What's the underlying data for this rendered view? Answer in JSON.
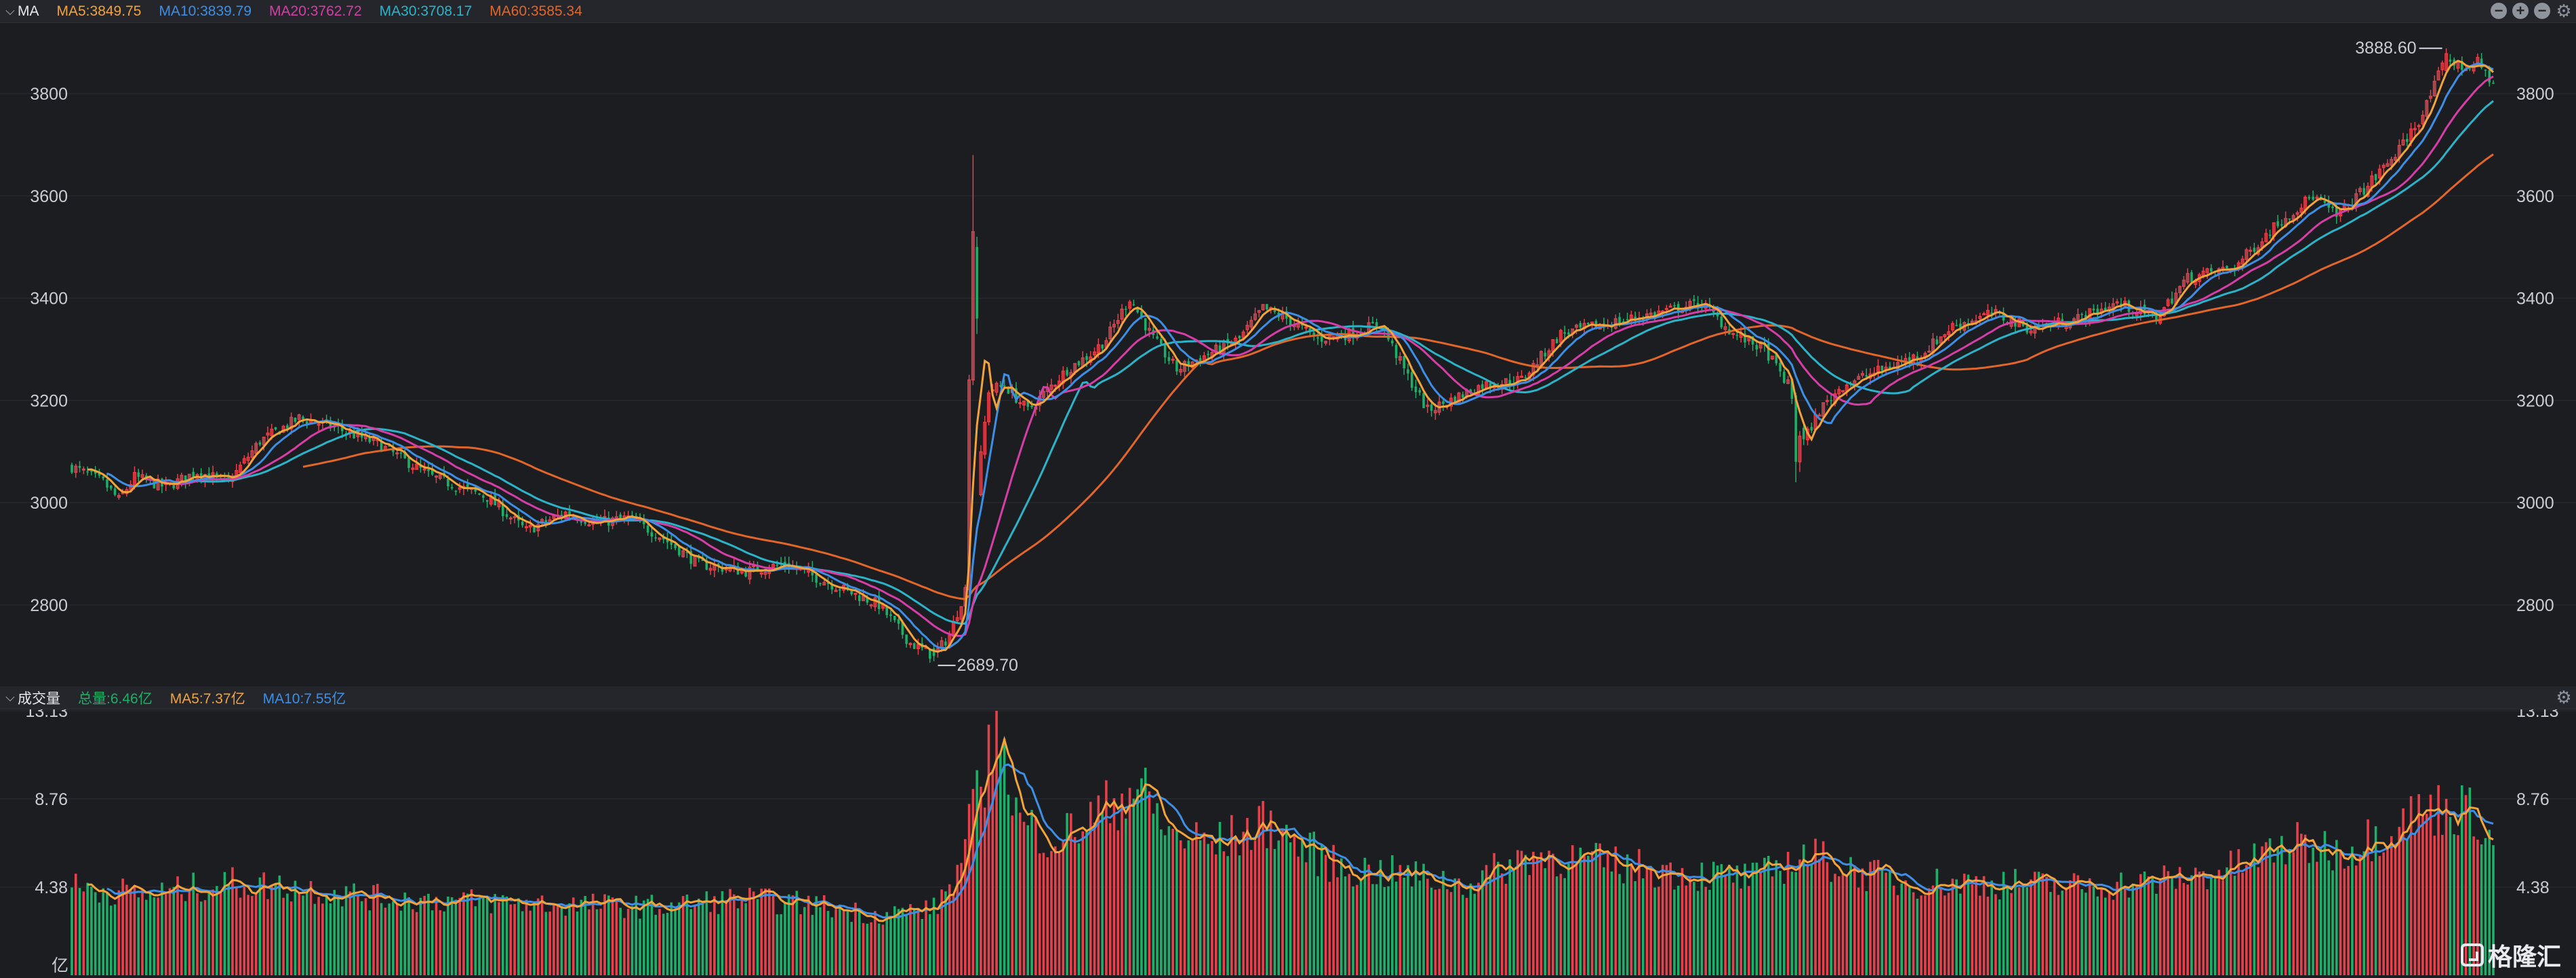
{
  "main_header": {
    "title": "MA",
    "ma5": "MA5:3849.75",
    "ma10": "MA10:3839.79",
    "ma20": "MA20:3762.72",
    "ma30": "MA30:3708.17",
    "ma60": "MA60:3585.34"
  },
  "volume_header": {
    "title": "成交量",
    "total": "总量:6.46亿",
    "ma5": "MA5:7.37亿",
    "ma10": "MA10:7.55亿"
  },
  "colors": {
    "up": "#e5414a",
    "down": "#1fae67",
    "ma5": "#f2a33a",
    "ma10": "#3d8fe6",
    "ma20": "#d63ea7",
    "ma30": "#2bb4c9",
    "ma60": "#e2662a"
  },
  "watermark": "格隆汇",
  "chart_data": [
    {
      "type": "candlestick",
      "y_ticks": [
        "3800",
        "3600",
        "3400",
        "3200",
        "3000",
        "2800"
      ],
      "ylim": [
        2650,
        3930
      ],
      "grid": true,
      "annotations": {
        "high": "3888.60",
        "low": "2689.70"
      },
      "anchors": [
        [
          0,
          3070
        ],
        [
          8,
          3040
        ],
        [
          12,
          3005
        ],
        [
          16,
          3050
        ],
        [
          24,
          3030
        ],
        [
          32,
          3060
        ],
        [
          40,
          3040
        ],
        [
          48,
          3120
        ],
        [
          58,
          3165
        ],
        [
          66,
          3150
        ],
        [
          78,
          3115
        ],
        [
          92,
          3050
        ],
        [
          106,
          3010
        ],
        [
          116,
          2945
        ],
        [
          126,
          2980
        ],
        [
          134,
          2960
        ],
        [
          142,
          2970
        ],
        [
          150,
          2935
        ],
        [
          160,
          2880
        ],
        [
          172,
          2865
        ],
        [
          182,
          2880
        ],
        [
          194,
          2840
        ],
        [
          206,
          2800
        ],
        [
          214,
          2725
        ],
        [
          220,
          2700
        ],
        [
          224,
          2740
        ],
        [
          228,
          2830
        ],
        [
          234,
          3220
        ],
        [
          238,
          3230
        ],
        [
          244,
          3180
        ],
        [
          254,
          3260
        ],
        [
          260,
          3290
        ],
        [
          264,
          3320
        ],
        [
          270,
          3400
        ],
        [
          276,
          3320
        ],
        [
          282,
          3260
        ],
        [
          290,
          3290
        ],
        [
          298,
          3320
        ],
        [
          304,
          3380
        ],
        [
          310,
          3360
        ],
        [
          318,
          3320
        ],
        [
          326,
          3330
        ],
        [
          334,
          3350
        ],
        [
          340,
          3260
        ],
        [
          346,
          3180
        ],
        [
          352,
          3200
        ],
        [
          360,
          3230
        ],
        [
          370,
          3240
        ],
        [
          380,
          3330
        ],
        [
          392,
          3350
        ],
        [
          404,
          3370
        ],
        [
          416,
          3390
        ],
        [
          424,
          3330
        ],
        [
          432,
          3300
        ],
        [
          438,
          3230
        ],
        [
          442,
          3120
        ],
        [
          446,
          3180
        ],
        [
          452,
          3230
        ],
        [
          462,
          3260
        ],
        [
          472,
          3290
        ],
        [
          480,
          3345
        ],
        [
          490,
          3370
        ],
        [
          500,
          3340
        ],
        [
          512,
          3360
        ],
        [
          522,
          3390
        ],
        [
          532,
          3360
        ],
        [
          540,
          3440
        ],
        [
          552,
          3460
        ],
        [
          562,
          3540
        ],
        [
          572,
          3600
        ],
        [
          578,
          3560
        ],
        [
          586,
          3620
        ],
        [
          594,
          3690
        ],
        [
          600,
          3760
        ],
        [
          606,
          3870
        ],
        [
          610,
          3850
        ],
        [
          614,
          3860
        ],
        [
          618,
          3820
        ]
      ],
      "volume_anchors": [
        [
          0,
          4.4
        ],
        [
          20,
          4.0
        ],
        [
          40,
          4.6
        ],
        [
          60,
          4.3
        ],
        [
          80,
          3.8
        ],
        [
          100,
          3.7
        ],
        [
          130,
          3.5
        ],
        [
          150,
          3.4
        ],
        [
          170,
          3.8
        ],
        [
          190,
          3.5
        ],
        [
          205,
          3.0
        ],
        [
          220,
          3.3
        ],
        [
          226,
          5.0
        ],
        [
          232,
          9.5
        ],
        [
          236,
          12.0
        ],
        [
          242,
          7.5
        ],
        [
          252,
          6.8
        ],
        [
          262,
          8.0
        ],
        [
          272,
          9.5
        ],
        [
          280,
          7.0
        ],
        [
          292,
          6.5
        ],
        [
          306,
          7.6
        ],
        [
          312,
          6.6
        ],
        [
          324,
          5.3
        ],
        [
          340,
          5.0
        ],
        [
          356,
          4.5
        ],
        [
          372,
          6.0
        ],
        [
          390,
          5.6
        ],
        [
          410,
          5.1
        ],
        [
          430,
          4.8
        ],
        [
          442,
          6.0
        ],
        [
          452,
          5.4
        ],
        [
          466,
          4.6
        ],
        [
          490,
          4.6
        ],
        [
          510,
          4.4
        ],
        [
          530,
          4.6
        ],
        [
          550,
          5.2
        ],
        [
          566,
          6.5
        ],
        [
          580,
          6.2
        ],
        [
          596,
          7.8
        ],
        [
          606,
          8.4
        ],
        [
          614,
          8.0
        ],
        [
          618,
          6.46
        ]
      ],
      "ma5_last": 7.37,
      "ma10_last": 7.55
    },
    {
      "type": "bar",
      "name": "成交量",
      "y_ticks": [
        "13.13",
        "8.76",
        "4.38"
      ],
      "ylim": [
        0,
        13.13
      ],
      "unit": "亿"
    }
  ]
}
